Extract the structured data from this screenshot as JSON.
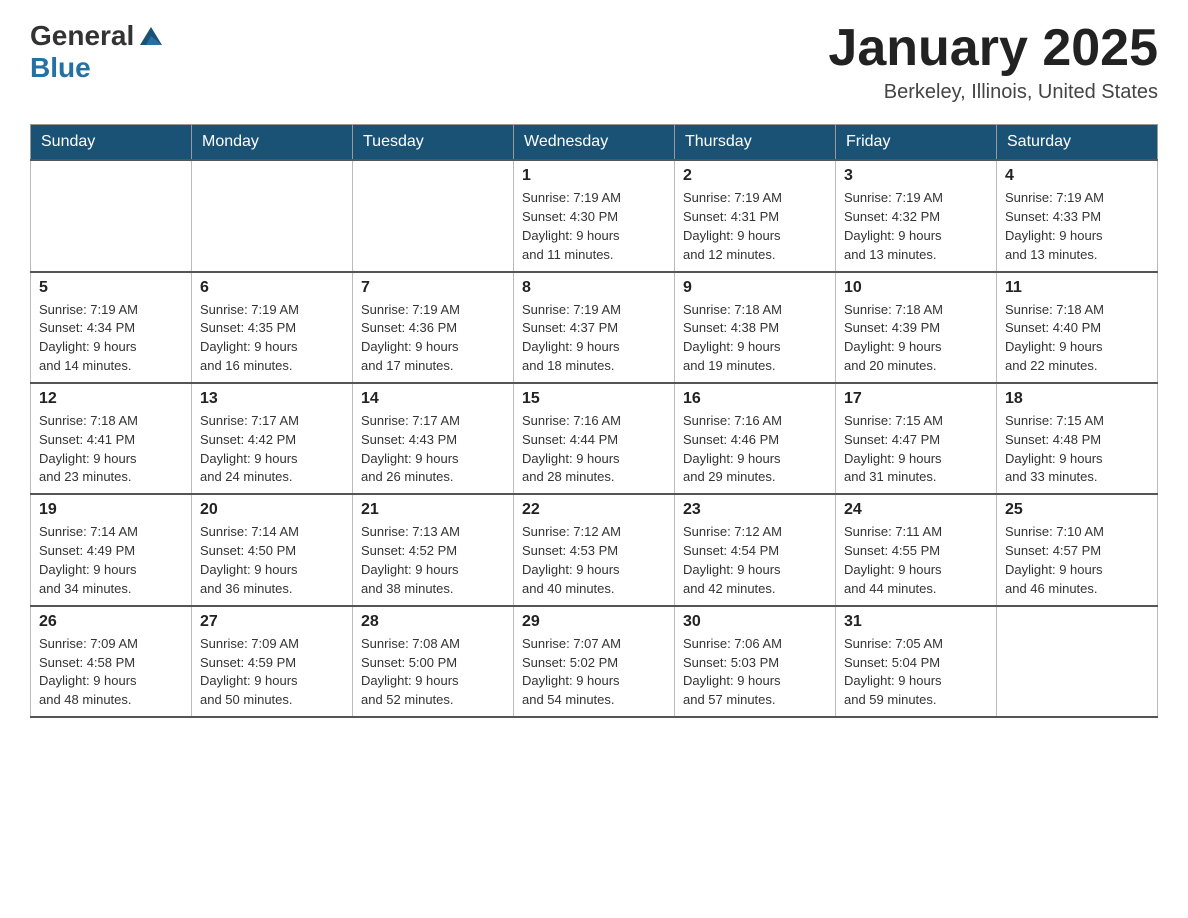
{
  "header": {
    "logo_general": "General",
    "logo_blue": "Blue",
    "title": "January 2025",
    "subtitle": "Berkeley, Illinois, United States"
  },
  "days_of_week": [
    "Sunday",
    "Monday",
    "Tuesday",
    "Wednesday",
    "Thursday",
    "Friday",
    "Saturday"
  ],
  "weeks": [
    [
      {
        "day": "",
        "info": ""
      },
      {
        "day": "",
        "info": ""
      },
      {
        "day": "",
        "info": ""
      },
      {
        "day": "1",
        "info": "Sunrise: 7:19 AM\nSunset: 4:30 PM\nDaylight: 9 hours\nand 11 minutes."
      },
      {
        "day": "2",
        "info": "Sunrise: 7:19 AM\nSunset: 4:31 PM\nDaylight: 9 hours\nand 12 minutes."
      },
      {
        "day": "3",
        "info": "Sunrise: 7:19 AM\nSunset: 4:32 PM\nDaylight: 9 hours\nand 13 minutes."
      },
      {
        "day": "4",
        "info": "Sunrise: 7:19 AM\nSunset: 4:33 PM\nDaylight: 9 hours\nand 13 minutes."
      }
    ],
    [
      {
        "day": "5",
        "info": "Sunrise: 7:19 AM\nSunset: 4:34 PM\nDaylight: 9 hours\nand 14 minutes."
      },
      {
        "day": "6",
        "info": "Sunrise: 7:19 AM\nSunset: 4:35 PM\nDaylight: 9 hours\nand 16 minutes."
      },
      {
        "day": "7",
        "info": "Sunrise: 7:19 AM\nSunset: 4:36 PM\nDaylight: 9 hours\nand 17 minutes."
      },
      {
        "day": "8",
        "info": "Sunrise: 7:19 AM\nSunset: 4:37 PM\nDaylight: 9 hours\nand 18 minutes."
      },
      {
        "day": "9",
        "info": "Sunrise: 7:18 AM\nSunset: 4:38 PM\nDaylight: 9 hours\nand 19 minutes."
      },
      {
        "day": "10",
        "info": "Sunrise: 7:18 AM\nSunset: 4:39 PM\nDaylight: 9 hours\nand 20 minutes."
      },
      {
        "day": "11",
        "info": "Sunrise: 7:18 AM\nSunset: 4:40 PM\nDaylight: 9 hours\nand 22 minutes."
      }
    ],
    [
      {
        "day": "12",
        "info": "Sunrise: 7:18 AM\nSunset: 4:41 PM\nDaylight: 9 hours\nand 23 minutes."
      },
      {
        "day": "13",
        "info": "Sunrise: 7:17 AM\nSunset: 4:42 PM\nDaylight: 9 hours\nand 24 minutes."
      },
      {
        "day": "14",
        "info": "Sunrise: 7:17 AM\nSunset: 4:43 PM\nDaylight: 9 hours\nand 26 minutes."
      },
      {
        "day": "15",
        "info": "Sunrise: 7:16 AM\nSunset: 4:44 PM\nDaylight: 9 hours\nand 28 minutes."
      },
      {
        "day": "16",
        "info": "Sunrise: 7:16 AM\nSunset: 4:46 PM\nDaylight: 9 hours\nand 29 minutes."
      },
      {
        "day": "17",
        "info": "Sunrise: 7:15 AM\nSunset: 4:47 PM\nDaylight: 9 hours\nand 31 minutes."
      },
      {
        "day": "18",
        "info": "Sunrise: 7:15 AM\nSunset: 4:48 PM\nDaylight: 9 hours\nand 33 minutes."
      }
    ],
    [
      {
        "day": "19",
        "info": "Sunrise: 7:14 AM\nSunset: 4:49 PM\nDaylight: 9 hours\nand 34 minutes."
      },
      {
        "day": "20",
        "info": "Sunrise: 7:14 AM\nSunset: 4:50 PM\nDaylight: 9 hours\nand 36 minutes."
      },
      {
        "day": "21",
        "info": "Sunrise: 7:13 AM\nSunset: 4:52 PM\nDaylight: 9 hours\nand 38 minutes."
      },
      {
        "day": "22",
        "info": "Sunrise: 7:12 AM\nSunset: 4:53 PM\nDaylight: 9 hours\nand 40 minutes."
      },
      {
        "day": "23",
        "info": "Sunrise: 7:12 AM\nSunset: 4:54 PM\nDaylight: 9 hours\nand 42 minutes."
      },
      {
        "day": "24",
        "info": "Sunrise: 7:11 AM\nSunset: 4:55 PM\nDaylight: 9 hours\nand 44 minutes."
      },
      {
        "day": "25",
        "info": "Sunrise: 7:10 AM\nSunset: 4:57 PM\nDaylight: 9 hours\nand 46 minutes."
      }
    ],
    [
      {
        "day": "26",
        "info": "Sunrise: 7:09 AM\nSunset: 4:58 PM\nDaylight: 9 hours\nand 48 minutes."
      },
      {
        "day": "27",
        "info": "Sunrise: 7:09 AM\nSunset: 4:59 PM\nDaylight: 9 hours\nand 50 minutes."
      },
      {
        "day": "28",
        "info": "Sunrise: 7:08 AM\nSunset: 5:00 PM\nDaylight: 9 hours\nand 52 minutes."
      },
      {
        "day": "29",
        "info": "Sunrise: 7:07 AM\nSunset: 5:02 PM\nDaylight: 9 hours\nand 54 minutes."
      },
      {
        "day": "30",
        "info": "Sunrise: 7:06 AM\nSunset: 5:03 PM\nDaylight: 9 hours\nand 57 minutes."
      },
      {
        "day": "31",
        "info": "Sunrise: 7:05 AM\nSunset: 5:04 PM\nDaylight: 9 hours\nand 59 minutes."
      },
      {
        "day": "",
        "info": ""
      }
    ]
  ]
}
